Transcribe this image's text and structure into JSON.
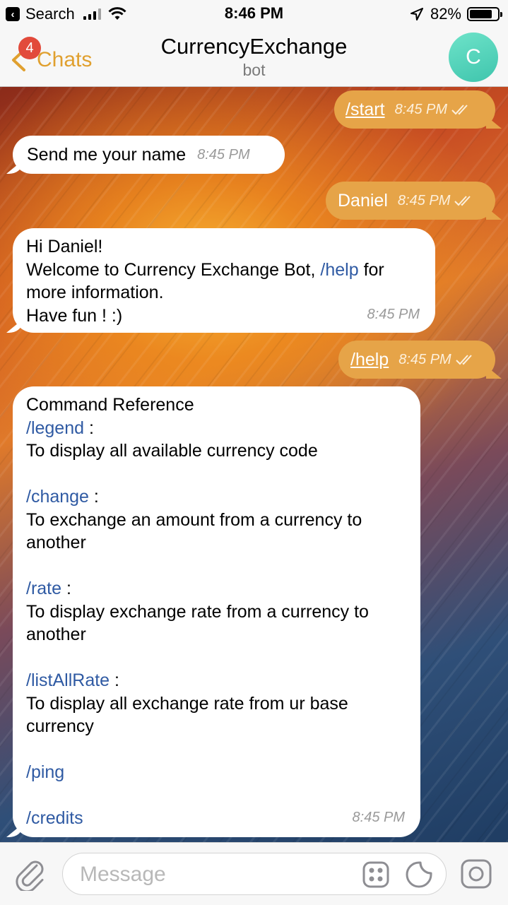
{
  "status_bar": {
    "carrier": "Search",
    "time": "8:46 PM",
    "battery": "82%",
    "battery_level": 0.82
  },
  "nav": {
    "back_label": "Chats",
    "badge_count": "4",
    "title": "CurrencyExchange",
    "subtitle": "bot",
    "avatar_letter": "C"
  },
  "messages": [
    {
      "dir": "out",
      "text": "/start",
      "time": "8:45 PM"
    },
    {
      "dir": "in",
      "text": "Send me your name",
      "time": "8:45 PM"
    },
    {
      "dir": "out",
      "text": "Daniel",
      "time": "8:45 PM"
    },
    {
      "dir": "in",
      "line1": "Hi Daniel!",
      "line2_before": "Welcome to Currency Exchange Bot, ",
      "line2_cmd": "/help",
      "line2_after": " for",
      "line3": "more information.",
      "line4": "Have fun ! :)",
      "time": "8:45 PM"
    },
    {
      "dir": "out",
      "text": "/help",
      "time": "8:45 PM"
    },
    {
      "dir": "in",
      "heading": "Command Reference",
      "legend_cmd": "/legend",
      "legend_colon": " :",
      "legend_desc": "To display all available currency code",
      "change_cmd": "/change",
      "change_colon": " :",
      "change_desc_1": "To exchange an amount from a currency to",
      "change_desc_2": "another",
      "rate_cmd": "/rate",
      "rate_colon": " :",
      "rate_desc_1": "To display exchange rate from a currency to",
      "rate_desc_2": "another",
      "listall_cmd": "/listAllRate",
      "listall_colon": " :",
      "listall_desc_1": "To display all exchange rate from ur base",
      "listall_desc_2": "currency",
      "ping_cmd": "/ping",
      "credits_cmd": "/credits",
      "time": "8:45 PM"
    }
  ],
  "input": {
    "placeholder": "Message"
  },
  "icons": {
    "attach": "paperclip-icon",
    "commands": "bot-commands-icon",
    "sticker": "sticker-icon",
    "camera": "camera-icon",
    "read": "double-check-icon"
  },
  "colors": {
    "accent": "#e0a02f",
    "outgoing_bubble": "#e6a448",
    "command_link": "#2f5aa3",
    "badge": "#e24a3b",
    "avatar": "#4fd1b8"
  }
}
